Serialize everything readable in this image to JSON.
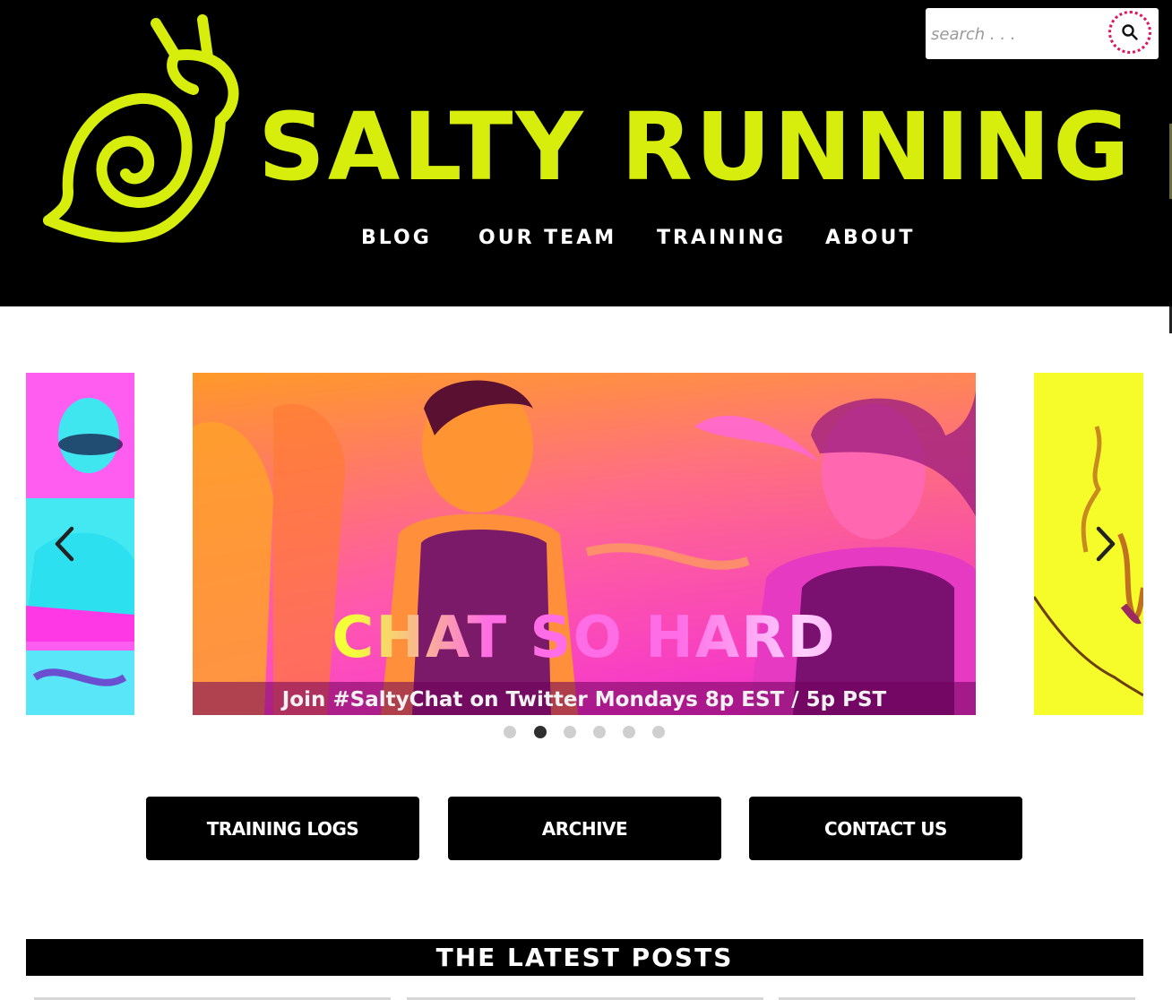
{
  "colors": {
    "header_bg": "#000000",
    "brand_lime": "#d7ee0c",
    "search_accent": "#e0145e",
    "button_bg": "#000000",
    "button_text": "#ffffff"
  },
  "header": {
    "logo_icon": "snail-icon",
    "site_title": "SALTY RUNNING",
    "nav": [
      {
        "label": "BLOG"
      },
      {
        "label": "OUR TEAM"
      },
      {
        "label": "TRAINING"
      },
      {
        "label": "ABOUT"
      }
    ],
    "search": {
      "placeholder": "search . . .",
      "icon": "search-icon"
    }
  },
  "slider": {
    "headline": "CHAT SO HARD",
    "caption": "Join #SaltyChat on Twitter Mondays 8p EST / 5p PST",
    "prev_icon": "chevron-left-icon",
    "next_icon": "chevron-right-icon",
    "slide_count": 6,
    "active_slide": 2
  },
  "buttons": [
    {
      "label": "TRAINING LOGS"
    },
    {
      "label": "ARCHIVE"
    },
    {
      "label": "CONTACT US"
    }
  ],
  "latest": {
    "title": "THE LATEST POSTS"
  }
}
